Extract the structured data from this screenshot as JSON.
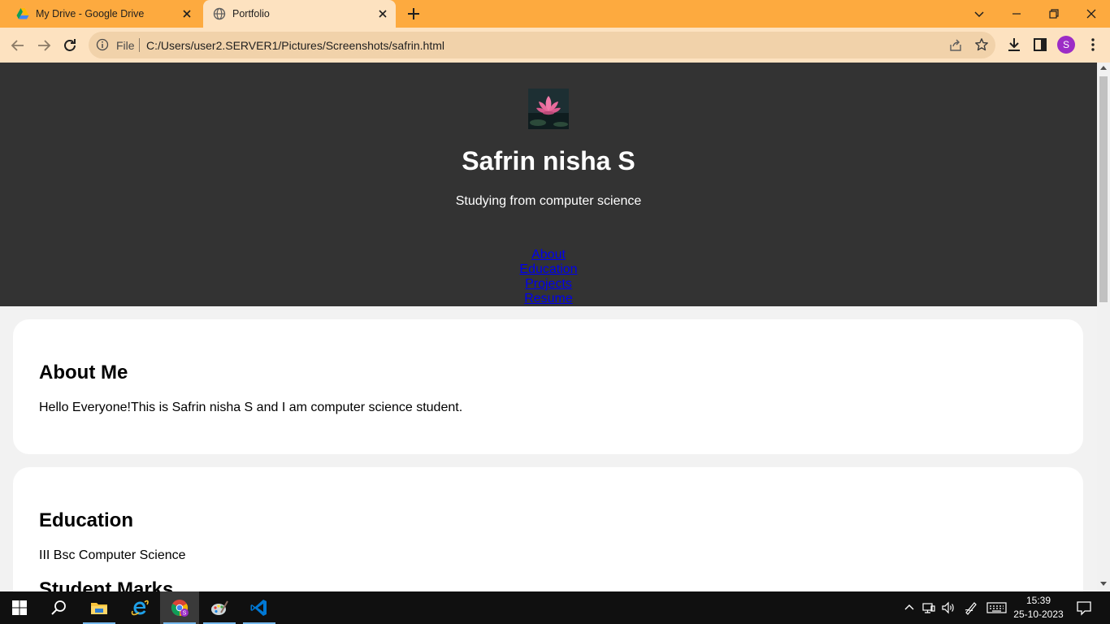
{
  "browser": {
    "tabs": [
      {
        "title": "My Drive - Google Drive",
        "active": false
      },
      {
        "title": "Portfolio",
        "active": true
      }
    ],
    "address": {
      "scheme": "File",
      "url": "C:/Users/user2.SERVER1/Pictures/Screenshots/safrin.html"
    },
    "profile_initial": "S",
    "colors": {
      "tabstrip": "#fdaa3f",
      "toolbar": "#fde2c0",
      "omnibox": "#f1d2aa"
    }
  },
  "page": {
    "header": {
      "name": "Safrin nisha S",
      "tagline": "Studying from computer science",
      "nav": [
        "About",
        "Education",
        "Projects",
        "Resume"
      ]
    },
    "about": {
      "heading": "About Me",
      "text": "Hello Everyone!This is Safrin nisha S and I am computer science student."
    },
    "education": {
      "heading": "Education",
      "degree": "III Bsc Computer Science",
      "subheading": "Student Marks"
    },
    "colors": {
      "header_bg": "#333333",
      "link": "#0000ee",
      "body_bg": "#f2f2f2"
    }
  },
  "taskbar": {
    "apps": [
      "start-icon",
      "search-icon",
      "file-explorer-icon",
      "internet-explorer-icon",
      "chrome-icon",
      "paint-icon",
      "vscode-icon"
    ],
    "time": "15:39",
    "date": "25-10-2023"
  }
}
